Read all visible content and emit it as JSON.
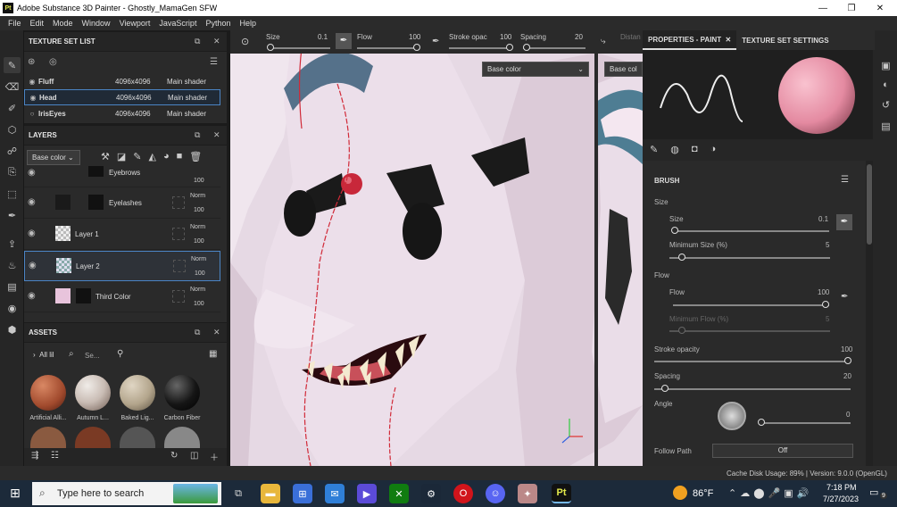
{
  "window": {
    "title": "Adobe Substance 3D Painter - Ghostly_MamaGen SFW",
    "logo": "Pt"
  },
  "menu": [
    "File",
    "Edit",
    "Mode",
    "Window",
    "Viewport",
    "JavaScript",
    "Python",
    "Help"
  ],
  "texture_set_list": {
    "title": "TEXTURE SET LIST",
    "rows": [
      {
        "name": "Fluff",
        "res": "4096x4096",
        "shader": "Main shader"
      },
      {
        "name": "Head",
        "res": "4096x4096",
        "shader": "Main shader"
      },
      {
        "name": "IrisEyes",
        "res": "4096x4096",
        "shader": "Main shader"
      }
    ]
  },
  "layers": {
    "title": "LAYERS",
    "channel": "Base color",
    "items": [
      {
        "name": "Eyebrows",
        "blend": "Norm",
        "opacity": "100"
      },
      {
        "name": "Eyelashes",
        "blend": "Norm",
        "opacity": "100"
      },
      {
        "name": "Layer 1",
        "blend": "Norm",
        "opacity": "100"
      },
      {
        "name": "Layer 2",
        "blend": "Norm",
        "opacity": "100"
      },
      {
        "name": "Third Color",
        "blend": "Norm",
        "opacity": "100"
      }
    ]
  },
  "assets": {
    "title": "ASSETS",
    "filter": "All lil",
    "search": "Se...",
    "items": [
      {
        "name": "Artificial Alli...",
        "color": "#a14a2d"
      },
      {
        "name": "Autumn L...",
        "color": "#8c3a24"
      },
      {
        "name": "Baked Lig...",
        "color": "#b3a58c"
      },
      {
        "name": "Carbon Fiber",
        "color": "#151515"
      }
    ]
  },
  "viewport_toolbar": {
    "size_label": "Size",
    "size_value": "0.1",
    "flow_label": "Flow",
    "flow_value": "100",
    "stroke_label": "Stroke opac",
    "stroke_value": "100",
    "spacing_label": "Spacing",
    "spacing_value": "20",
    "distance_label": "Distan",
    "channel_left": "Base color",
    "channel_right": "Base col"
  },
  "properties": {
    "tabs": [
      "PROPERTIES - PAINT",
      "TEXTURE SET SETTINGS"
    ],
    "brush_title": "BRUSH",
    "size_section": "Size",
    "size_label": "Size",
    "size_value": "0.1",
    "min_size_label": "Minimum Size (%)",
    "min_size_value": "5",
    "flow_section": "Flow",
    "flow_label": "Flow",
    "flow_value": "100",
    "min_flow_label": "Minimum Flow (%)",
    "min_flow_value": "5",
    "stroke_label": "Stroke opacity",
    "stroke_value": "100",
    "spacing_label": "Spacing",
    "spacing_value": "20",
    "angle_label": "Angle",
    "angle_value": "0",
    "follow_label": "Follow Path",
    "follow_value": "Off"
  },
  "status": {
    "text": "Cache Disk Usage:  89% | Version: 9.0.0 (OpenGL)"
  },
  "taskbar": {
    "search": "Type here to search",
    "weather": "86°F",
    "time": "7:18 PM",
    "date": "7/27/2023",
    "notif": "9"
  },
  "colors": {
    "accent": "#4b84c4",
    "skin": "#e7d5e4",
    "nose": "#c8283a"
  }
}
